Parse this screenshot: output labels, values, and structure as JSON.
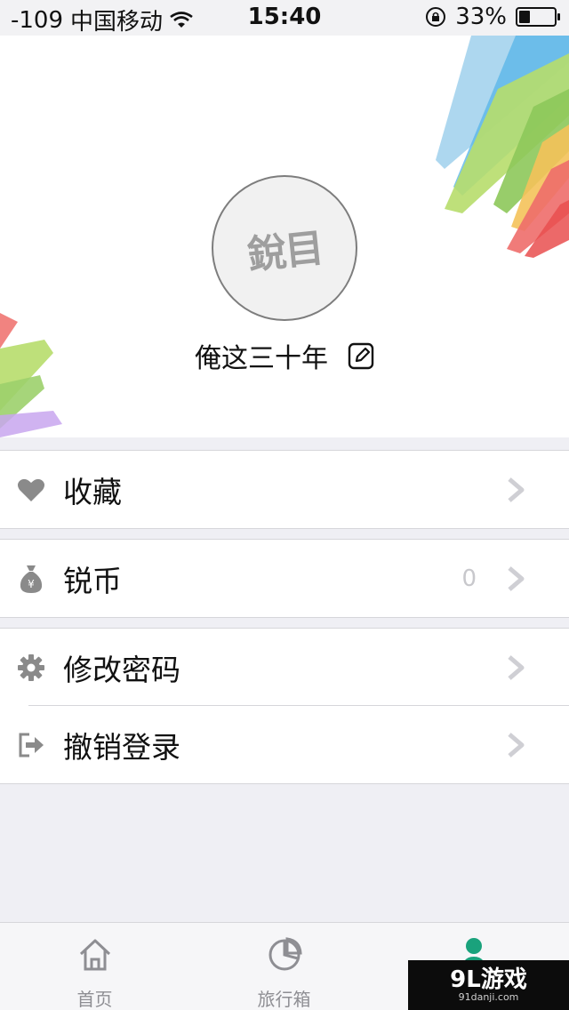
{
  "status_bar": {
    "signal": "-109",
    "carrier": "中国移动",
    "time": "15:40",
    "battery_percent": "33%",
    "battery_level": 0.33
  },
  "profile": {
    "avatar_text": "銳目",
    "username": "俺这三十年",
    "edit_icon": "edit-icon"
  },
  "menu": {
    "favorites": {
      "label": "收藏",
      "icon": "heart-icon"
    },
    "coins": {
      "label": "锐币",
      "icon": "money-bag-icon",
      "value": "0"
    },
    "change_password": {
      "label": "修改密码",
      "icon": "gear-icon"
    },
    "logout": {
      "label": "撤销登录",
      "icon": "logout-icon"
    }
  },
  "tab_bar": {
    "tabs": [
      {
        "label": "首页",
        "icon": "home-icon"
      },
      {
        "label": "旅行箱",
        "icon": "pie-chart-icon"
      },
      {
        "label": "",
        "icon": "profile-icon"
      }
    ]
  },
  "watermark": {
    "main": "9L游戏",
    "sub": "91danji.com"
  },
  "colors": {
    "accent": "#1aa27c",
    "background": "#efeff4",
    "chevron": "#cfcfd4",
    "icon_gray": "#8a8a8a"
  }
}
